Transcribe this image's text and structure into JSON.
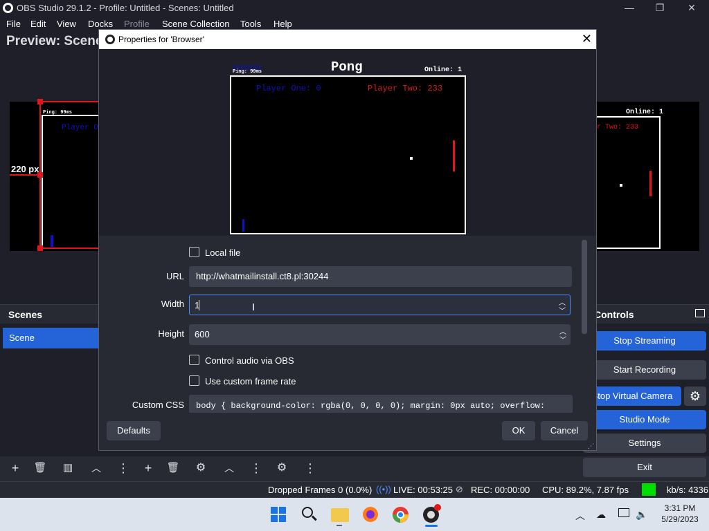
{
  "window": {
    "title": "OBS Studio 29.1.2 - Profile: Untitled - Scenes: Untitled",
    "minimize": "—",
    "maximize": "❐",
    "close": "✕"
  },
  "menu": {
    "items": [
      "File",
      "Edit",
      "View",
      "Docks",
      "Profile",
      "Scene Collection",
      "Tools",
      "Help"
    ]
  },
  "preview": {
    "title": "Preview: Scene",
    "size_label": "220 px",
    "ping": "Ping: 99ms",
    "online": "Online: 1",
    "player_one_partial": "Player O",
    "player_two_partial": "r Two: 233"
  },
  "scenes": {
    "header": "Scenes",
    "items": [
      "Scene"
    ]
  },
  "controls": {
    "header": "Controls",
    "stop_streaming": "Stop Streaming",
    "start_recording": "Start Recording",
    "stop_virtual_camera": "Stop Virtual Camera",
    "studio_mode": "Studio Mode",
    "settings": "Settings",
    "exit": "Exit"
  },
  "status": {
    "dropped_frames": "Dropped Frames 0 (0.0%)",
    "live": "LIVE: 00:53:25",
    "rec": "REC: 00:00:00",
    "cpu": "CPU: 89.2%, 7.87 fps",
    "kbps": "kb/s: 4336",
    "bitrate_color": "#00e000"
  },
  "dialog": {
    "title": "Properties for 'Browser'",
    "close": "✕",
    "pong": {
      "heading": "Pong",
      "ping": "Ping: 99ms",
      "online": "Online: 1",
      "player_one": "Player One: 0",
      "player_two": "Player Two: 233",
      "player_one_color": "#1010c8",
      "player_two_color": "#e01818"
    },
    "local_file_label": "Local file",
    "url_label": "URL",
    "url_value": "http://whatmailinstall.ct8.pl:30244",
    "width_label": "Width",
    "width_value": "1",
    "height_label": "Height",
    "height_value": "600",
    "control_audio_label": "Control audio via OBS",
    "custom_fps_label": "Use custom frame rate",
    "custom_css_label": "Custom CSS",
    "custom_css_value": "body { background-color: rgba(0, 0, 0, 0); margin: 0px auto; overflow:",
    "defaults_button": "Defaults",
    "ok_button": "OK",
    "cancel_button": "Cancel"
  },
  "taskbar": {
    "time": "3:31 PM",
    "date": "5/29/2023"
  }
}
